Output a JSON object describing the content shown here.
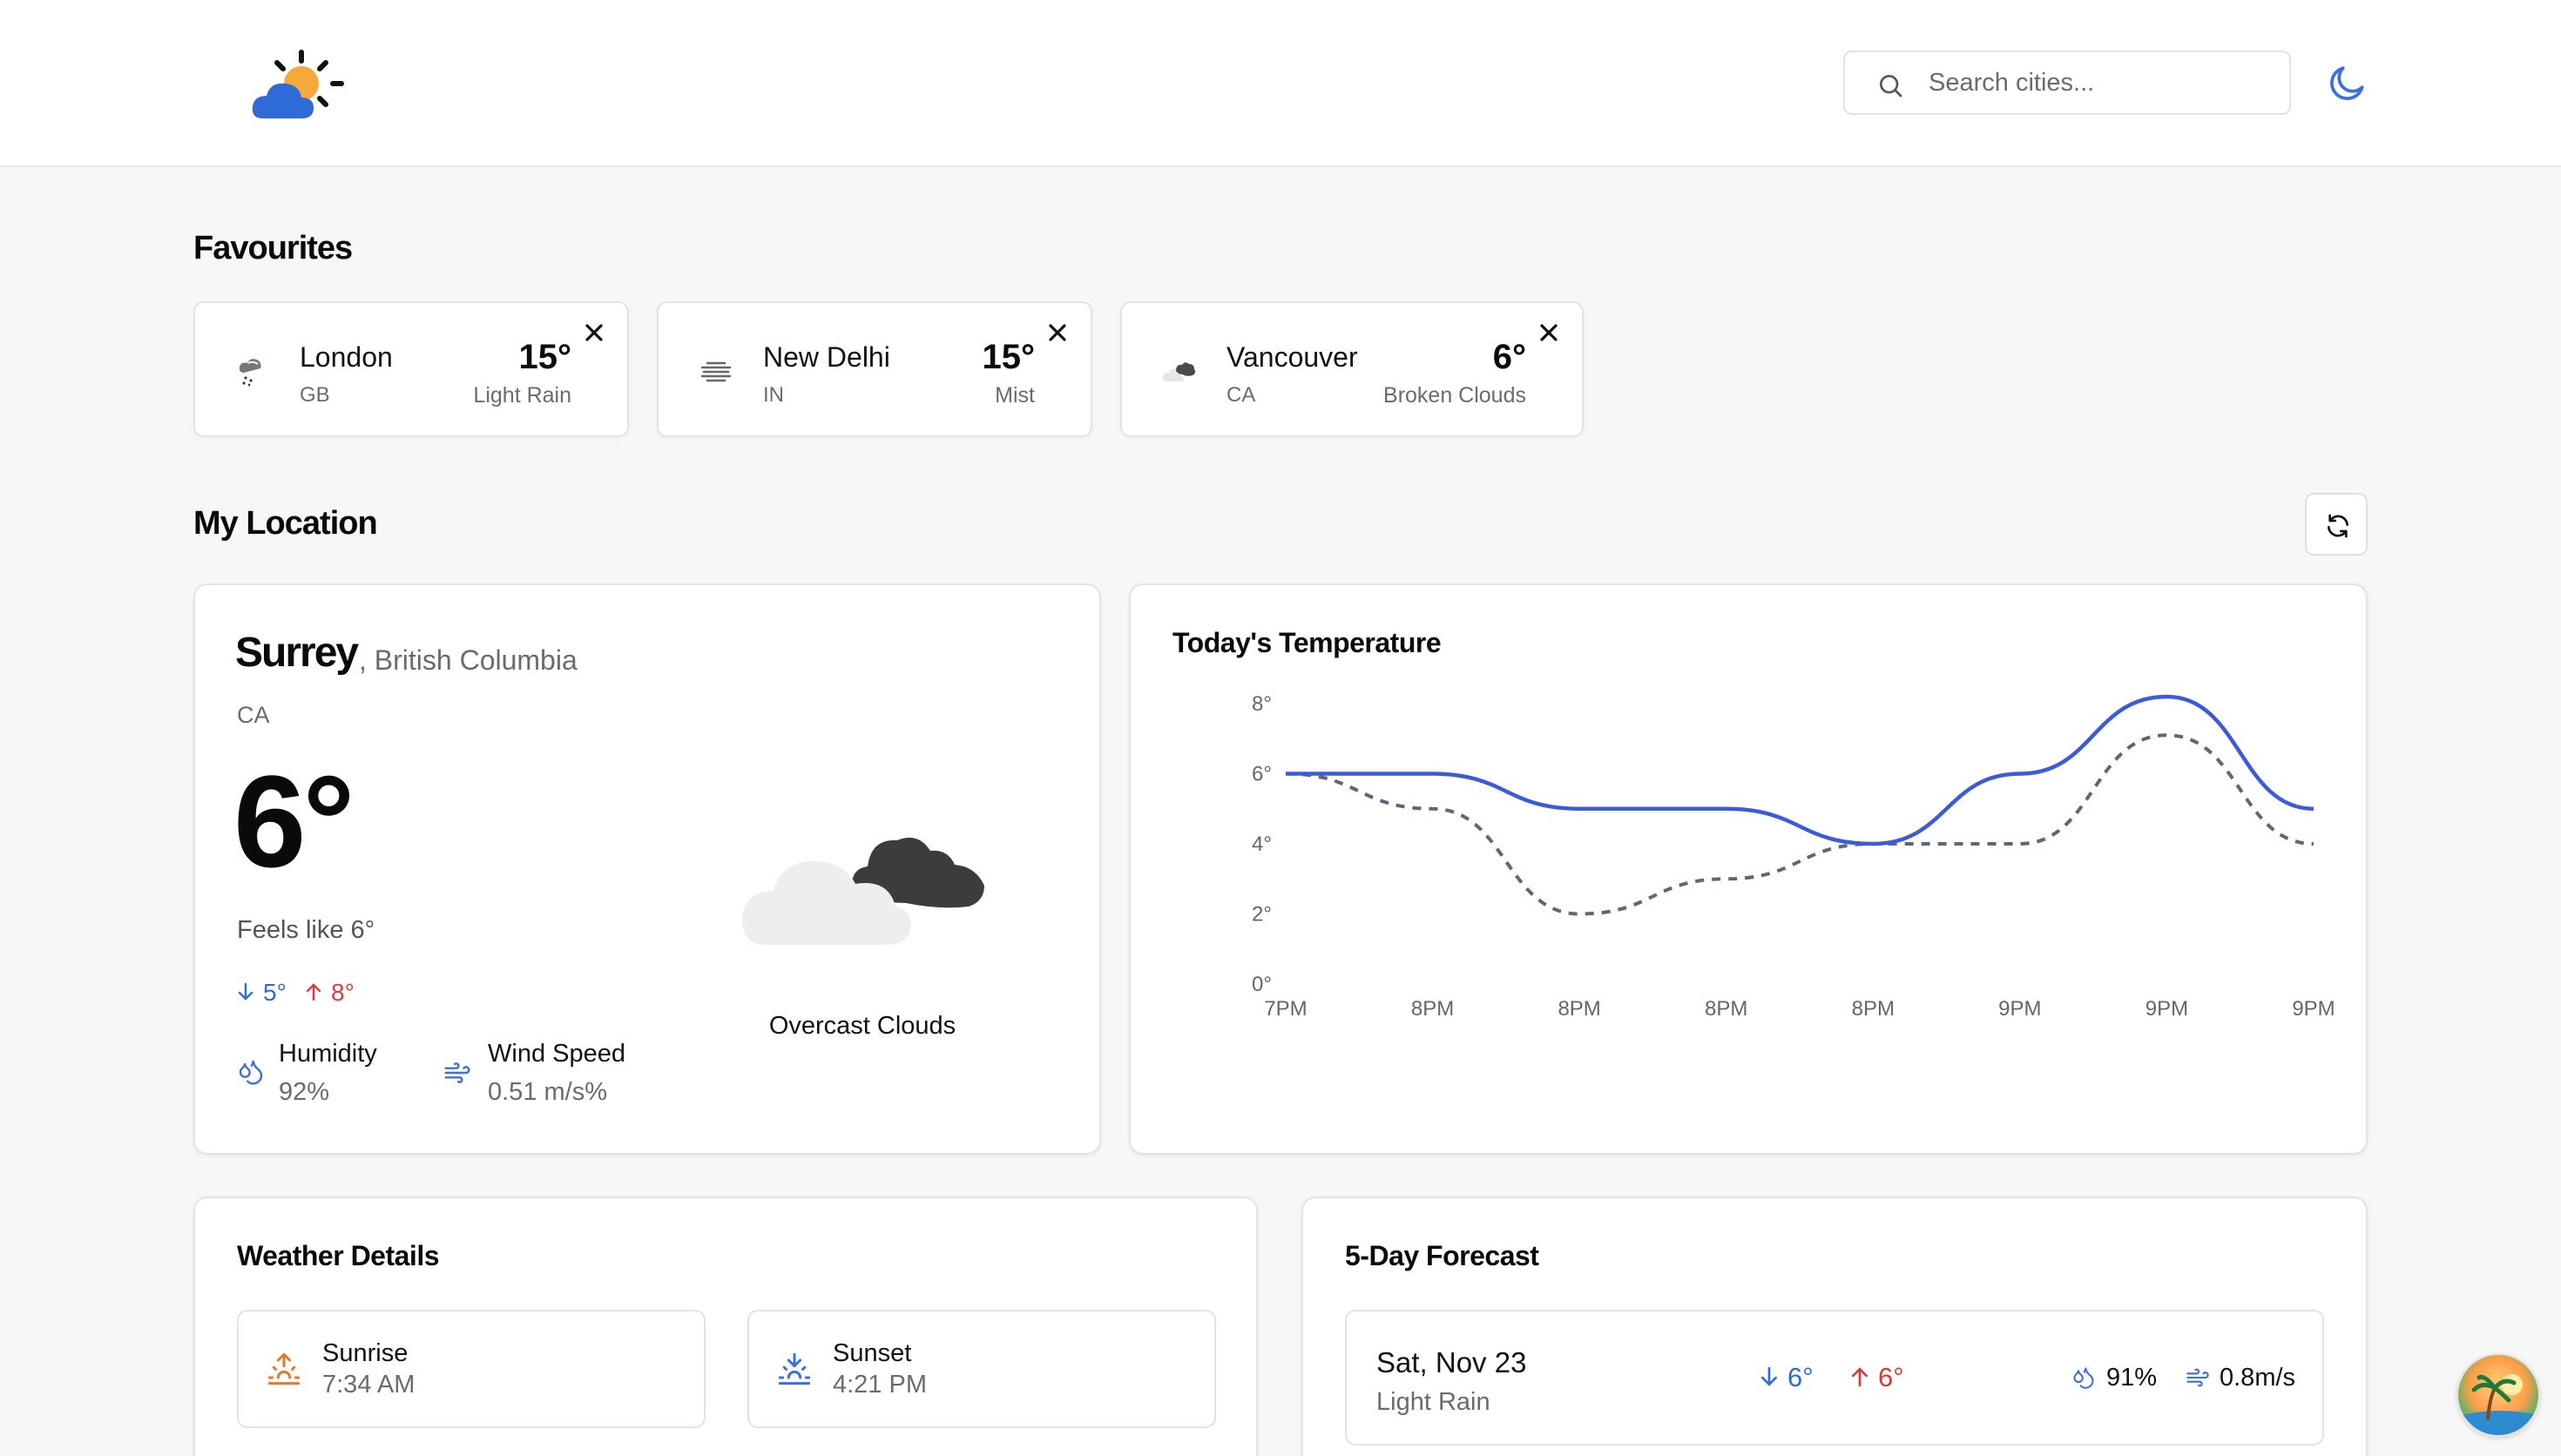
{
  "header": {
    "logo_icon": "partly-cloudy-sun-icon",
    "search_placeholder": "Search cities...",
    "theme_icon": "moon-icon"
  },
  "favourites": {
    "title": "Favourites",
    "items": [
      {
        "city": "London",
        "country": "GB",
        "temp": "15°",
        "condition": "Light Rain",
        "icon": "rain-icon"
      },
      {
        "city": "New Delhi",
        "country": "IN",
        "temp": "15°",
        "condition": "Mist",
        "icon": "mist-icon"
      },
      {
        "city": "Vancouver",
        "country": "CA",
        "temp": "6°",
        "condition": "Broken Clouds",
        "icon": "broken-clouds-icon"
      }
    ]
  },
  "my_location": {
    "title": "My Location",
    "city": "Surrey",
    "region": ", British Columbia",
    "country": "CA",
    "temp": "6°",
    "feels_like": "Feels like 6°",
    "temp_min": "5°",
    "temp_max": "8°",
    "humidity_label": "Humidity",
    "humidity_value": "92%",
    "wind_label": "Wind Speed",
    "wind_value": "0.51 m/s%",
    "condition": "Overcast Clouds",
    "condition_icon": "overcast-clouds-icon"
  },
  "chart_data": {
    "type": "line",
    "title": "Today's Temperature",
    "categories": [
      "7PM",
      "8PM",
      "8PM",
      "8PM",
      "8PM",
      "9PM",
      "9PM",
      "9PM"
    ],
    "y_tick_labels": [
      "0°",
      "2°",
      "4°",
      "6°",
      "8°"
    ],
    "series": [
      {
        "values": [
          6,
          6,
          5,
          5,
          4,
          6,
          8.2,
          5
        ],
        "color": "#3b5bdb",
        "style": "solid"
      },
      {
        "values": [
          6,
          5,
          2,
          3,
          4,
          4,
          7.1,
          4
        ],
        "color": "#5f6679",
        "style": "dashed"
      }
    ],
    "ylim": [
      0,
      8
    ],
    "grid": false
  },
  "weather_details": {
    "title": "Weather Details",
    "sunrise_label": "Sunrise",
    "sunrise_value": "7:34 AM",
    "sunset_label": "Sunset",
    "sunset_value": "4:21 PM"
  },
  "forecast": {
    "title": "5-Day Forecast",
    "days": [
      {
        "date": "Sat, Nov 23",
        "condition": "Light Rain",
        "min": "6°",
        "max": "6°",
        "humidity": "91%",
        "wind": "0.8m/s"
      }
    ]
  },
  "colors": {
    "accent": "#3b5bdb",
    "min_temp": "#2f6bd7",
    "max_temp": "#d63b3b",
    "sunrise_icon": "#e8772e"
  }
}
